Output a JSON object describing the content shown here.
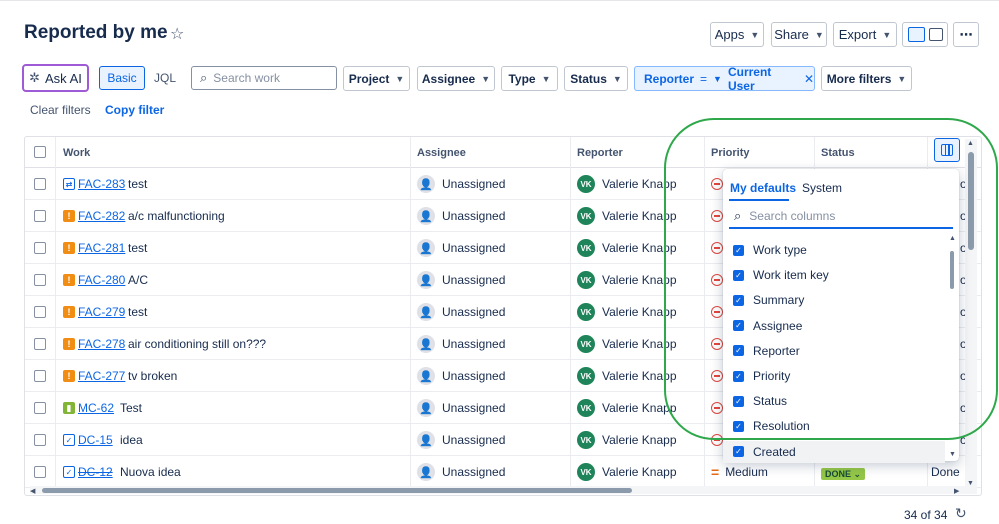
{
  "header": {
    "title": "Reported by me",
    "buttons": [
      "Apps",
      "Share",
      "Export"
    ],
    "more": "⋯"
  },
  "filters": {
    "ask_ai": "Ask AI",
    "basic": "Basic",
    "jql": "JQL",
    "search_placeholder": "Search work",
    "project": "Project",
    "assignee": "Assignee",
    "type": "Type",
    "status": "Status",
    "reporter_label": "Reporter",
    "reporter_op": "=",
    "reporter_value": "Current User",
    "more_filters": "More filters",
    "clear": "Clear filters",
    "copy": "Copy filter"
  },
  "table": {
    "columns": [
      "Work",
      "Assignee",
      "Reporter",
      "Priority",
      "Status"
    ],
    "rows": [
      {
        "key": "FAC-283",
        "summary": "test",
        "type": "subtask",
        "assignee": "Unassigned",
        "reporter": "Valerie Knapp",
        "initials": "VK",
        "priority": "",
        "status": "",
        "partial": "o"
      },
      {
        "key": "FAC-282",
        "summary": "a/c malfunctioning",
        "type": "bug",
        "assignee": "Unassigned",
        "reporter": "Valerie Knapp",
        "initials": "VK",
        "priority": "",
        "status": "",
        "partial": "o"
      },
      {
        "key": "FAC-281",
        "summary": "test",
        "type": "bug",
        "assignee": "Unassigned",
        "reporter": "Valerie Knapp",
        "initials": "VK",
        "priority": "",
        "status": "",
        "partial": "o"
      },
      {
        "key": "FAC-280",
        "summary": "A/C",
        "type": "bug",
        "assignee": "Unassigned",
        "reporter": "Valerie Knapp",
        "initials": "VK",
        "priority": "",
        "status": "",
        "partial": "o"
      },
      {
        "key": "FAC-279",
        "summary": "test",
        "type": "bug",
        "assignee": "Unassigned",
        "reporter": "Valerie Knapp",
        "initials": "VK",
        "priority": "",
        "status": "",
        "partial": "o"
      },
      {
        "key": "FAC-278",
        "summary": "air conditioning still on???",
        "type": "bug",
        "assignee": "Unassigned",
        "reporter": "Valerie Knapp",
        "initials": "VK",
        "priority": "",
        "status": "",
        "partial": "o"
      },
      {
        "key": "FAC-277",
        "summary": "tv broken",
        "type": "bug",
        "assignee": "Unassigned",
        "reporter": "Valerie Knapp",
        "initials": "VK",
        "priority": "",
        "status": "",
        "partial": "o"
      },
      {
        "key": "MC-62",
        "summary": "Test",
        "type": "story",
        "assignee": "Unassigned",
        "reporter": "Valerie Knapp",
        "initials": "VK",
        "priority": "",
        "status": "",
        "partial": "o"
      },
      {
        "key": "DC-15",
        "summary": "idea",
        "type": "idea",
        "assignee": "Unassigned",
        "reporter": "Valerie Knapp",
        "initials": "VK",
        "priority": "",
        "status": "",
        "partial": "o"
      },
      {
        "key": "DC-12",
        "summary": "Nuova idea",
        "type": "idea",
        "assignee": "Unassigned",
        "reporter": "Valerie Knapp",
        "initials": "VK",
        "priority": "Medium",
        "status": "DONE",
        "partial": "Done"
      }
    ]
  },
  "column_picker": {
    "tab_defaults": "My defaults",
    "tab_system": "System",
    "search_placeholder": "Search columns",
    "items": [
      "Work type",
      "Work item key",
      "Summary",
      "Assignee",
      "Reporter",
      "Priority",
      "Status",
      "Resolution",
      "Created"
    ]
  },
  "footer": {
    "count": "34 of 34"
  },
  "colors": {
    "accent": "#0c66e4",
    "annotation": "#2ea84a",
    "ai_border": "#9f5bd6"
  }
}
